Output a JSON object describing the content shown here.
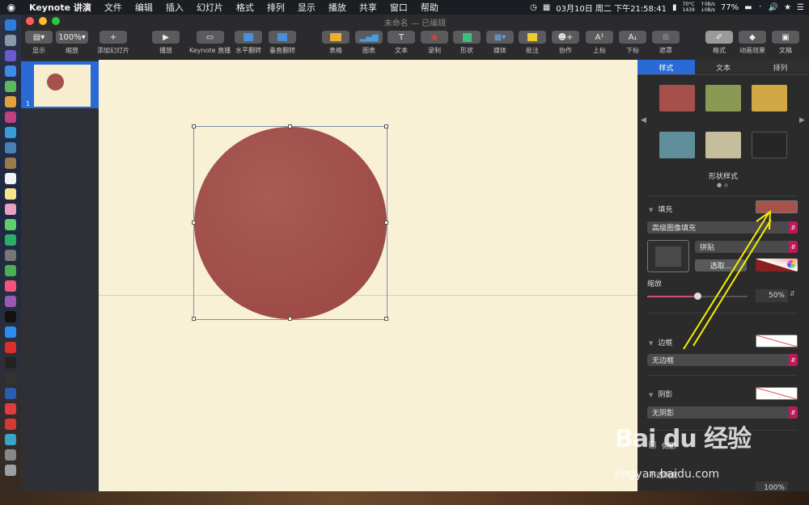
{
  "menubar": {
    "app_name": "Keynote 讲演",
    "items": [
      "文件",
      "编辑",
      "插入",
      "幻灯片",
      "格式",
      "排列",
      "显示",
      "播放",
      "共享",
      "窗口",
      "帮助"
    ],
    "datetime": "03月10日 周二 下午21:58:41",
    "temp": "70°C",
    "rpm": "1439",
    "net_up": "0B/s",
    "net_down": "0B/s",
    "battery": "77%"
  },
  "window": {
    "title": "未命名 — 已编辑"
  },
  "toolbar": {
    "view": "显示",
    "zoom_value": "100%",
    "zoom": "缩放",
    "add_slide": "添加幻灯片",
    "play": "播放",
    "keynote_live": "Keynote 直播",
    "flip_h": "水平翻转",
    "flip_v": "垂直翻转",
    "table": "表格",
    "chart": "图表",
    "text": "文本",
    "record": "录制",
    "shape": "形状",
    "media": "媒体",
    "comment": "批注",
    "collaborate": "协作",
    "superscript": "上标",
    "subscript": "下标",
    "mask": "遮罩",
    "format": "格式",
    "animate": "动画效果",
    "document": "文稿"
  },
  "navigator": {
    "slide_number": "1"
  },
  "inspector": {
    "tabs": [
      "样式",
      "文本",
      "排列"
    ],
    "styles_title": "形状样式",
    "swatch_colors": [
      "#a74f4a",
      "#8a9a55",
      "#d2a845",
      "#5f8f9a",
      "#c6bd9c",
      "#262626"
    ],
    "fill_label": "填充",
    "fill_type": "高级图像填充",
    "tile_option": "拼贴",
    "choose_button": "选取...",
    "scale_label": "缩放",
    "scale_value": "50%",
    "scale_fraction": 0.5,
    "border_label": "边框",
    "border_option": "无边框",
    "shadow_label": "阴影",
    "shadow_option": "无阴影",
    "reflection_label": "倒影",
    "opacity_label": "不透明度",
    "opacity_value": "100%",
    "fill_color": "#a8524c"
  },
  "watermark": {
    "logo": "Bai du 经验",
    "url": "jingyan.baidu.com"
  }
}
